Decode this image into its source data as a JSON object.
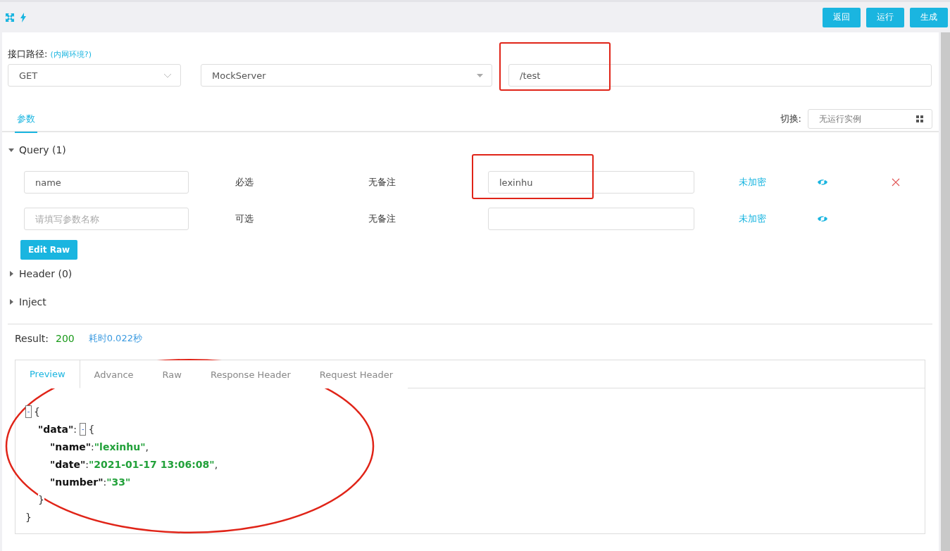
{
  "toolbar": {
    "buttons": [
      "返回",
      "运行",
      "生成"
    ]
  },
  "path": {
    "label": "接口路径:",
    "link": "(内网环境?)",
    "method": "GET",
    "server": "MockServer",
    "value": "/test"
  },
  "tabs": [
    {
      "label": "参数",
      "selected": true
    }
  ],
  "switch": {
    "label": "切换:",
    "value": "无运行实例"
  },
  "sections": [
    {
      "title": "Query (1)",
      "expanded": true,
      "params": [
        {
          "name": "name",
          "required": "必选",
          "remark": "无备注",
          "value": "lexinhu",
          "encrypt": "未加密",
          "removable": true
        },
        {
          "placeholder": "请填写参数名称",
          "required": "可选",
          "remark": "无备注",
          "encrypt": "未加密",
          "removable": false
        }
      ],
      "button": "Edit Raw"
    },
    {
      "title": "Header (0)",
      "expanded": false
    },
    {
      "title": "Inject",
      "expanded": false
    }
  ],
  "result": {
    "label": "Result:",
    "status": "200",
    "time": "耗时0.022秒"
  },
  "result_tabs": [
    {
      "label": "Preview",
      "selected": true
    },
    {
      "label": "Advance",
      "selected": false
    },
    {
      "label": "Raw",
      "selected": false
    },
    {
      "label": "Response Header",
      "selected": false
    },
    {
      "label": "Request Header",
      "selected": false
    }
  ],
  "json_view": [
    {
      "kind": "open",
      "toggle": "-",
      "brace": "{"
    },
    {
      "kind": "key_open",
      "key": "\"data\"",
      "sep": ":",
      "toggle": "-",
      "brace": "{"
    },
    {
      "kind": "pair",
      "key": "\"name\"",
      "sep": ":",
      "value": "\"lexinhu\"",
      "comma": ","
    },
    {
      "kind": "pair",
      "key": "\"date\"",
      "sep": ":",
      "value": "\"2021-01-17 13:06:08\"",
      "comma": ","
    },
    {
      "kind": "pair",
      "key": "\"number\"",
      "sep": ":",
      "value": "\"33\""
    },
    {
      "kind": "close_inner",
      "brace": "}"
    },
    {
      "kind": "close",
      "brace": "}"
    }
  ],
  "annotations": [
    {
      "kind": "rect"
    },
    {
      "kind": "rect"
    },
    {
      "kind": "ellipse"
    }
  ]
}
